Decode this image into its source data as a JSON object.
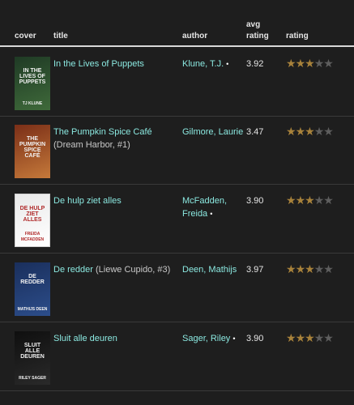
{
  "header": {
    "cover": "cover",
    "title": "title",
    "author": "author",
    "avg_line1": "avg",
    "avg_line2": "rating",
    "rating": "rating"
  },
  "books": [
    {
      "title": "In the Lives of Puppets",
      "series": "",
      "author": "Klune, T.J.",
      "author_dot": "•",
      "avg_rating": "3.92",
      "stars": 3,
      "cover_text": "IN THE LIVES OF PUPPETS",
      "cover_author": "TJ KLUNE",
      "cover_colors": [
        "#1f3a25",
        "#3f6a3a"
      ]
    },
    {
      "title": "The Pumpkin Spice Café",
      "series": "(Dream Harbor, #1)",
      "author": "Gilmore, Laurie",
      "author_dot": "",
      "avg_rating": "3.47",
      "stars": 3,
      "cover_text": "THE PUMPKIN SPICE CAFÉ",
      "cover_author": "",
      "cover_colors": [
        "#7a2e17",
        "#c5793a"
      ]
    },
    {
      "title": "De hulp ziet alles",
      "series": "",
      "author": "McFadden, Freida",
      "author_dot": "•",
      "avg_rating": "3.90",
      "stars": 3,
      "cover_text": "DE HULP ZIET ALLES",
      "cover_author": "FREIDA MCFADDEN",
      "cover_colors": [
        "#e9e9e9",
        "#ffffff"
      ]
    },
    {
      "title": "De redder",
      "series": "(Liewe Cupido, #3)",
      "author": "Deen, Mathijs",
      "author_dot": "",
      "avg_rating": "3.97",
      "stars": 3,
      "cover_text": "DE REDDER",
      "cover_author": "MATHIJS DEEN",
      "cover_colors": [
        "#1a2f5c",
        "#2c4d8a"
      ]
    },
    {
      "title": "Sluit alle deuren",
      "series": "",
      "author": "Sager, Riley",
      "author_dot": "•",
      "avg_rating": "3.90",
      "stars": 3,
      "cover_text": "SLUIT ALLE DEUREN",
      "cover_author": "RILEY SAGER",
      "cover_colors": [
        "#0f0f0f",
        "#2a2a2a"
      ]
    }
  ]
}
